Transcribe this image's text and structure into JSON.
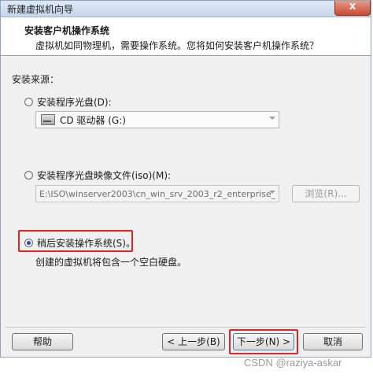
{
  "window": {
    "title": "新建虚拟机向导",
    "close_glyph": "X"
  },
  "header": {
    "title": "安装客户机操作系统",
    "description": "虚拟机如同物理机，需要操作系统。您将如何安装客户机操作系统？"
  },
  "install_source": {
    "label": "安装来源：",
    "options": [
      {
        "label": "安装程序光盘(D):",
        "selected": false
      },
      {
        "label": "安装程序光盘映像文件(iso)(M):",
        "selected": false
      },
      {
        "label": "稍后安装操作系统(S)。",
        "selected": true
      }
    ],
    "drive_dropdown": {
      "value": "CD 驱动器 (G:)",
      "icon": "optical-drive-icon"
    },
    "iso_path": {
      "value": "E:\\ISO\\winserver2003\\cn_win_srv_2003_r2_enterprise_"
    },
    "browse_label": "浏览(R)...",
    "later_description": "创建的虚拟机将包含一个空白硬盘。"
  },
  "footer": {
    "help_label": "帮助",
    "back_label": "< 上一步(B)",
    "next_label": "下一步(N) >",
    "cancel_label": "取消"
  },
  "watermark": "CSDN @raziya-askar",
  "colors": {
    "highlight": "#e22424",
    "radio_dot": "#2a4d9a"
  }
}
